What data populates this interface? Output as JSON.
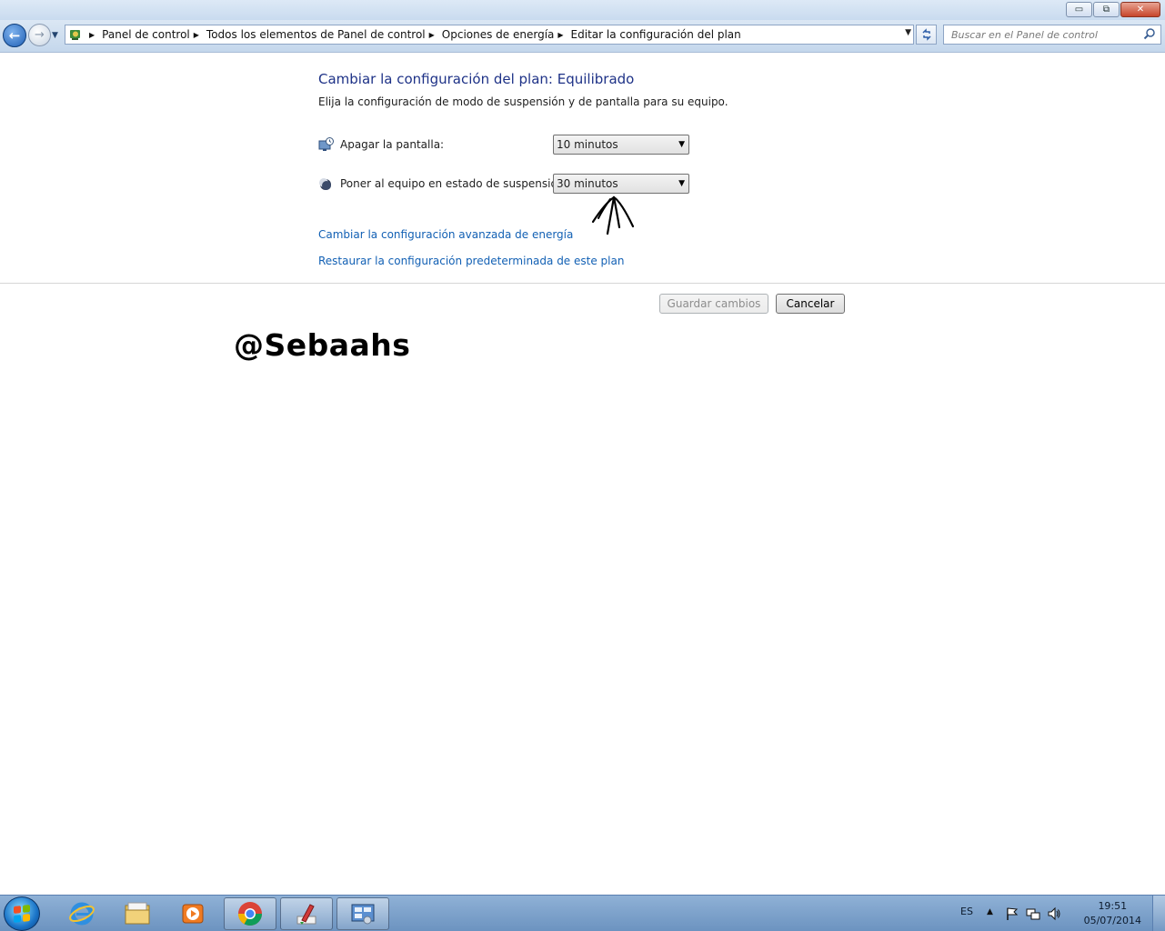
{
  "window": {
    "minimize_glyph": "▭",
    "restore_glyph": "⧉",
    "close_glyph": "✕"
  },
  "nav": {
    "back_glyph": "←",
    "forward_glyph": "→",
    "breadcrumbs": [
      "Panel de control",
      "Todos los elementos de Panel de control",
      "Opciones de energía",
      "Editar la configuración del plan"
    ],
    "search_placeholder": "Buscar en el Panel de control",
    "icons": [
      "back-arrow-icon",
      "forward-arrow-icon",
      "control-panel-icon",
      "refresh-icon",
      "search-icon"
    ]
  },
  "main": {
    "title": "Cambiar la configuración del plan: Equilibrado",
    "subtitle": "Elija la configuración de modo de suspensión y de pantalla para su equipo.",
    "settings": [
      {
        "label": "Apagar la pantalla:",
        "value": "10 minutos",
        "icon": "monitor-clock-icon"
      },
      {
        "label": "Poner al equipo en estado de suspensión:",
        "value": "30 minutos",
        "icon": "moon-sleep-icon"
      }
    ],
    "links": {
      "advanced": "Cambiar la configuración avanzada de energía",
      "restore": "Restaurar la configuración predeterminada de este plan"
    },
    "buttons": {
      "save": "Guardar cambios",
      "cancel": "Cancelar"
    },
    "watermark": "@Sebaahs"
  },
  "taskbar": {
    "apps": [
      "internet-explorer-icon",
      "windows-explorer-icon",
      "media-player-icon",
      "chrome-icon",
      "paint-tool-icon",
      "control-panel-window-icon"
    ],
    "tray": {
      "language": "ES",
      "time": "19:51",
      "date": "05/07/2014",
      "icons": [
        "action-center-flag-icon",
        "network-icon",
        "volume-icon"
      ]
    }
  },
  "colors": {
    "heading": "#1e3287",
    "link": "#1260b4",
    "taskbar": "#7a9fc9"
  }
}
